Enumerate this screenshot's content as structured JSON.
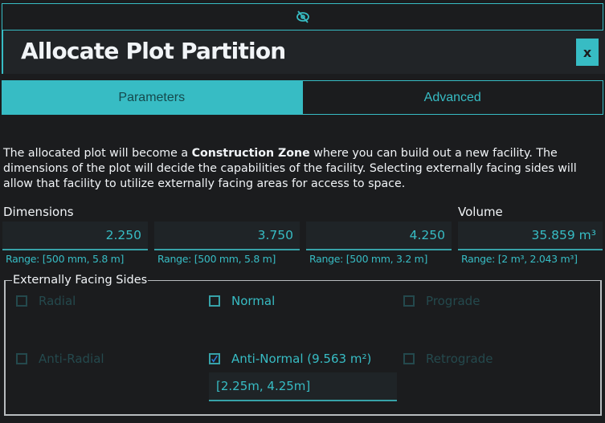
{
  "topbar": {
    "icon": "eye-off-icon"
  },
  "header": {
    "title": "Allocate Plot Partition",
    "close_label": "x"
  },
  "tabs": [
    {
      "label": "Parameters",
      "active": true
    },
    {
      "label": "Advanced",
      "active": false
    }
  ],
  "description": {
    "before": "The allocated plot will become a ",
    "emphasis": "Construction Zone",
    "after": " where you can build out a new facility. The dimensions of the plot will decide the capabilities of the facility. Selecting externally facing sides will allow that facility to utilize externally facing areas for access to space."
  },
  "dimensions": {
    "label": "Dimensions",
    "fields": [
      {
        "value": "2.250",
        "range": "Range: [500 mm, 5.8 m]"
      },
      {
        "value": "3.750",
        "range": "Range: [500 mm, 5.8 m]"
      },
      {
        "value": "4.250",
        "range": "Range: [500 mm, 3.2 m]"
      }
    ]
  },
  "volume": {
    "label": "Volume",
    "value": "35.859 m³",
    "range": "Range: [2 m³, 2.043 m³]"
  },
  "sides": {
    "legend": "Externally Facing Sides",
    "options": [
      {
        "label": "Radial",
        "checked": false,
        "enabled": false
      },
      {
        "label": "Normal",
        "checked": false,
        "enabled": true
      },
      {
        "label": "Prograde",
        "checked": false,
        "enabled": false
      },
      {
        "label": "Anti-Radial",
        "checked": false,
        "enabled": false
      },
      {
        "label": "Anti-Normal (9.563 m²)",
        "checked": true,
        "enabled": true
      },
      {
        "label": "Retrograde",
        "checked": false,
        "enabled": false
      }
    ],
    "anti_normal_extent": "[2.25m, 4.25m]"
  },
  "colors": {
    "accent": "#37bcc4",
    "background": "#1b1c1e",
    "check": "#2a7fe0"
  }
}
